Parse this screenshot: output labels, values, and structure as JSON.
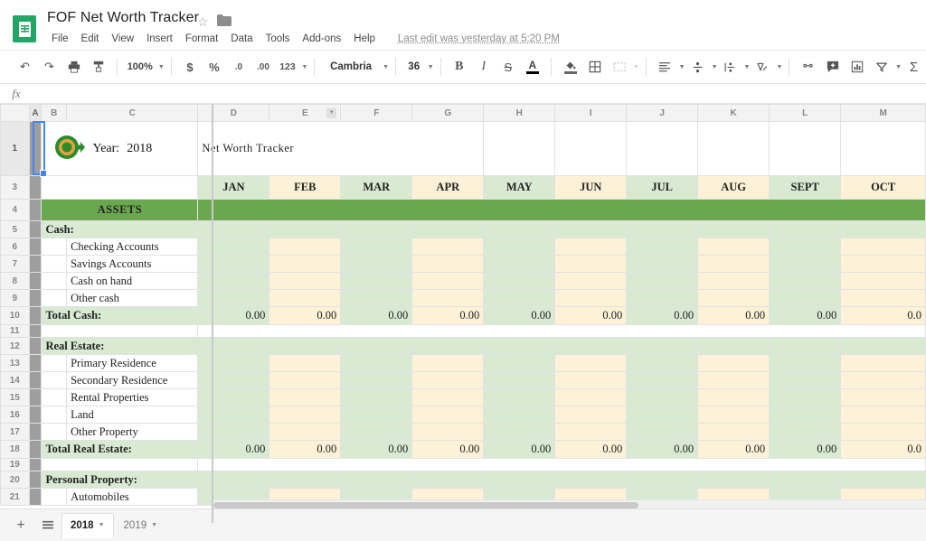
{
  "app": {
    "doc_title": "FOF Net Worth Tracker",
    "doc_icon": "sheets-icon",
    "star_icon": "star-icon",
    "folder_icon": "folder-icon",
    "last_edit": "Last edit was yesterday at 5:20 PM"
  },
  "menus": [
    "File",
    "Edit",
    "View",
    "Insert",
    "Format",
    "Data",
    "Tools",
    "Add-ons",
    "Help"
  ],
  "toolbar": {
    "undo": "↶",
    "redo": "↷",
    "print": "print-icon",
    "paint_format": "paint-format-icon",
    "zoom": "100%",
    "currency": "$",
    "percent": "%",
    "decrease_decimal": ".0",
    "increase_decimal": ".00",
    "more_formats": "123",
    "font": "Cambria",
    "font_size": "36",
    "bold": "B",
    "italic": "I",
    "strikethrough": "S",
    "text_color": "A",
    "fill_color": "fill-color-icon",
    "borders": "borders-icon",
    "merge_cells": "merge-cells-icon",
    "align": "align-icon",
    "valign": "vertical-align-icon",
    "text_wrap": "text-wrap-icon",
    "text_rotation": "text-rotation-icon",
    "link": "link-icon",
    "comment": "comment-icon",
    "chart": "chart-icon",
    "filter": "filter-icon",
    "functions": "Σ"
  },
  "formula_bar": {
    "fx": "fx",
    "value": ""
  },
  "grid": {
    "columns": [
      "A",
      "B",
      "C",
      "D",
      "E",
      "F",
      "G",
      "H",
      "I",
      "J",
      "K",
      "L",
      "M"
    ],
    "active_column": "E",
    "selected_cell": "A1",
    "row_numbers": [
      "1",
      "3",
      "4",
      "5",
      "6",
      "7",
      "8",
      "9",
      "10",
      "11",
      "12",
      "13",
      "14",
      "15",
      "16",
      "17",
      "18",
      "19",
      "20",
      "21"
    ],
    "title": "Net Worth Tracker",
    "year_label": "Year:",
    "year_value": "2018",
    "logo": "target-arrow-logo",
    "months": [
      "JAN",
      "FEB",
      "MAR",
      "APR",
      "MAY",
      "JUN",
      "JUL",
      "AUG",
      "SEPT",
      "OCT"
    ],
    "assets_header": "ASSETS",
    "sections": [
      {
        "row": "5",
        "label": "Cash:",
        "items": [
          {
            "row": "6",
            "label": "Checking Accounts"
          },
          {
            "row": "7",
            "label": "Savings Accounts"
          },
          {
            "row": "8",
            "label": "Cash on hand"
          },
          {
            "row": "9",
            "label": "Other cash"
          }
        ],
        "total_row": "10",
        "total_label": "Total Cash:",
        "total_values": [
          "0.00",
          "0.00",
          "0.00",
          "0.00",
          "0.00",
          "0.00",
          "0.00",
          "0.00",
          "0.00",
          "0.0"
        ]
      },
      {
        "row": "12",
        "label": "Real Estate:",
        "items": [
          {
            "row": "13",
            "label": "Primary Residence"
          },
          {
            "row": "14",
            "label": "Secondary Residence"
          },
          {
            "row": "15",
            "label": "Rental Properties"
          },
          {
            "row": "16",
            "label": "Land"
          },
          {
            "row": "17",
            "label": "Other Property"
          }
        ],
        "total_row": "18",
        "total_label": "Total Real Estate:",
        "total_values": [
          "0.00",
          "0.00",
          "0.00",
          "0.00",
          "0.00",
          "0.00",
          "0.00",
          "0.00",
          "0.00",
          "0.0"
        ]
      },
      {
        "row": "20",
        "label": "Personal Property:",
        "items": [
          {
            "row": "21",
            "label": "Automobiles"
          }
        ],
        "total_row": "",
        "total_label": "",
        "total_values": []
      }
    ]
  },
  "sheet_tabs": {
    "add_sheet": "+",
    "all_sheets": "all-sheets-icon",
    "tabs": [
      {
        "name": "2018",
        "active": true
      },
      {
        "name": "2019",
        "active": false
      }
    ]
  },
  "colors": {
    "brand_green": "#23a566",
    "header_green": "#6aa84f",
    "fill_green": "#d9ead3",
    "fill_cream": "#fdf2d8",
    "assets_text": "#ffff00",
    "selection_blue": "#4285f4"
  }
}
